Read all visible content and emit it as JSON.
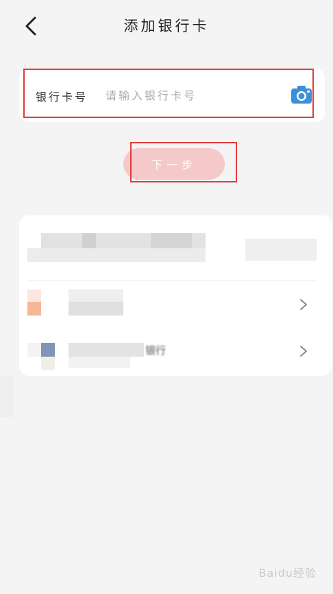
{
  "header": {
    "title": "添加银行卡",
    "back_icon": "chevron-left-icon"
  },
  "card_input": {
    "label": "银行卡号",
    "placeholder": "请输入银行卡号",
    "value": "",
    "camera_icon": "camera-icon"
  },
  "next_button": {
    "label": "下一步"
  },
  "bank_rows": [
    {
      "name": "",
      "chevron_icon": "chevron-right-icon"
    },
    {
      "name": "银行",
      "chevron_icon": "chevron-right-icon"
    }
  ],
  "colors": {
    "accent_red": "#e23b3b",
    "next_button_disabled": "#f5c9c9",
    "camera_blue": "#3d8fd6",
    "background": "#f4f4f4"
  },
  "watermark": "Baidu经验"
}
